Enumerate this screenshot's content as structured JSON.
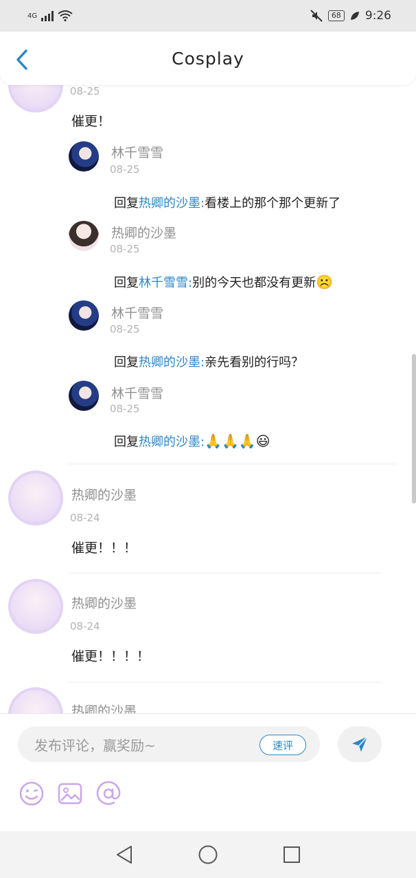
{
  "status_bar": {
    "network": "4G",
    "battery": "68",
    "time": "9:26"
  },
  "header": {
    "title": "Cosplay",
    "back_icon": "chevron-left-icon"
  },
  "colors": {
    "mention": "#2b86c9",
    "accent": "#2b86c9",
    "icon_purple": "#c9a6ea"
  },
  "thread": {
    "top_comment": {
      "date": "08-25",
      "text": "催更！"
    },
    "replies": [
      {
        "username": "林千雪雪",
        "date": "08-25",
        "reply_prefix": "回复",
        "mention": "热卿的沙墨",
        "separator": ":",
        "text": "看楼上的那个那个更新了",
        "emoji": ""
      },
      {
        "username": "热卿的沙墨",
        "date": "08-25",
        "reply_prefix": "回复",
        "mention": "林千雪雪",
        "separator": ":",
        "text": "别的今天也都没有更新",
        "emoji": "☹️"
      },
      {
        "username": "林千雪雪",
        "date": "08-25",
        "reply_prefix": "回复",
        "mention": "热卿的沙墨",
        "separator": ":",
        "text": "亲先看别的行吗？",
        "emoji": ""
      },
      {
        "username": "林千雪雪",
        "date": "08-25",
        "reply_prefix": "回复",
        "mention": "热卿的沙墨",
        "separator": ":",
        "text": "",
        "emoji": "🙏🙏🙏😃"
      }
    ]
  },
  "comments": [
    {
      "username": "热卿的沙墨",
      "date": "08-24",
      "text": "催更！！！"
    },
    {
      "username": "热卿的沙墨",
      "date": "08-24",
      "text": "催更！！！！"
    },
    {
      "username": "热卿的沙墨"
    }
  ],
  "composer": {
    "placeholder": "发布评论，赢奖励~",
    "quick_comment_label": "速评",
    "send_icon": "send-icon",
    "tools": [
      "emoji-icon",
      "image-icon",
      "at-icon"
    ]
  },
  "nav": {
    "back": "back-triangle-icon",
    "home": "home-circle-icon",
    "recents": "recents-square-icon"
  }
}
